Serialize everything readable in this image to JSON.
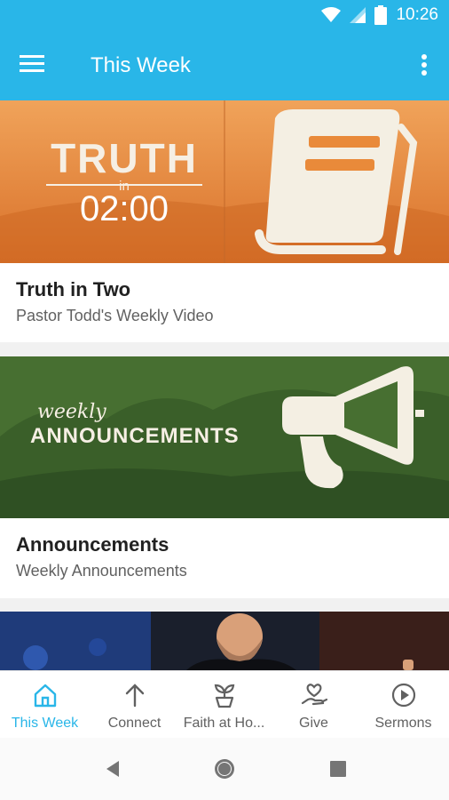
{
  "status_bar": {
    "time": "10:26",
    "icons": [
      "wifi-icon",
      "signal-icon",
      "battery-icon"
    ]
  },
  "app_bar": {
    "title": "This Week",
    "menu_icon": "hamburger-menu-icon",
    "more_icon": "more-vert-icon"
  },
  "cards": [
    {
      "title": "Truth in Two",
      "subtitle": "Pastor Todd's Weekly Video",
      "banner": {
        "line1": "TRUTH",
        "line2": "in",
        "line3": "02:00",
        "icon": "book-icon"
      }
    },
    {
      "title": "Announcements",
      "subtitle": "Weekly Announcements",
      "banner": {
        "line1": "weekly",
        "line2": "ANNOUNCEMENTS",
        "icon": "megaphone-icon"
      }
    }
  ],
  "bottom_nav": [
    {
      "label": "This Week",
      "icon": "home-icon",
      "active": true
    },
    {
      "label": "Connect",
      "icon": "arrow-up-icon",
      "active": false
    },
    {
      "label": "Faith at Ho...",
      "icon": "plant-icon",
      "active": false
    },
    {
      "label": "Give",
      "icon": "give-heart-hand-icon",
      "active": false
    },
    {
      "label": "Sermons",
      "icon": "play-circle-icon",
      "active": false
    }
  ],
  "colors": {
    "primary": "#29b6e8",
    "orange_banner": "#e98a3a",
    "green_banner": "#3f6b2f"
  }
}
